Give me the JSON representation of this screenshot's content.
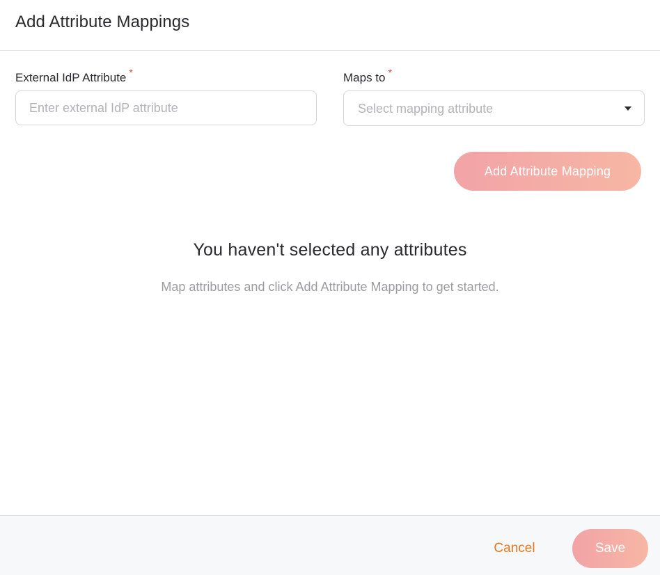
{
  "dialog": {
    "title": "Add Attribute Mappings"
  },
  "form": {
    "external_attribute": {
      "label": "External IdP Attribute",
      "required_marker": "*",
      "placeholder": "Enter external IdP attribute",
      "value": ""
    },
    "maps_to": {
      "label": "Maps to",
      "required_marker": "*",
      "placeholder": "Select mapping attribute",
      "selected_value": ""
    },
    "add_button_label": "Add Attribute Mapping"
  },
  "empty_state": {
    "title": "You haven't selected any attributes",
    "description": "Map attributes and click Add Attribute Mapping to get started."
  },
  "footer": {
    "cancel_label": "Cancel",
    "save_label": "Save"
  },
  "colors": {
    "accent_orange": "#e8771e",
    "button_gradient_start": "#f2a3a7",
    "button_gradient_end": "#f7b7a4",
    "required_red": "#e0453a"
  },
  "icons": {
    "dropdown": "caret-down-icon"
  }
}
